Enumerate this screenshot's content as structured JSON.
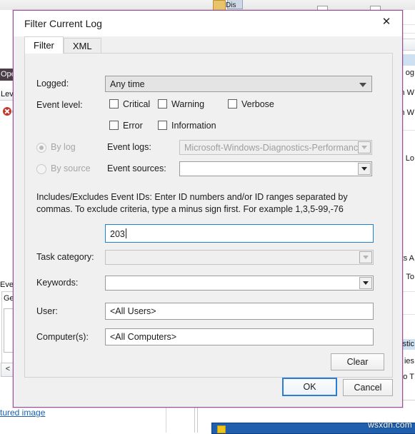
{
  "background": {
    "toolbar_label": "Dis",
    "left_selected_row": "Open",
    "left_column_header": "Leve",
    "left_error_row": "C",
    "lower_panel_title": "Even",
    "lower_panel_tab": "Ge",
    "prev_button": "<",
    "link_text": "tured image",
    "right_rows": [
      "og",
      "m W",
      "m W",
      "Lo",
      "ts A",
      "To",
      "stic",
      "ies",
      "o T"
    ],
    "watermark": "wsxdn.com"
  },
  "dialog": {
    "title": "Filter Current Log",
    "close_label": "✕",
    "tabs": [
      {
        "label": "Filter",
        "active": true
      },
      {
        "label": "XML",
        "active": false
      }
    ],
    "fields": {
      "logged_label": "Logged:",
      "logged_value": "Any time",
      "event_level_label": "Event level:",
      "levels": [
        {
          "label": "Critical",
          "checked": false
        },
        {
          "label": "Warning",
          "checked": false
        },
        {
          "label": "Verbose",
          "checked": false
        },
        {
          "label": "Error",
          "checked": false
        },
        {
          "label": "Information",
          "checked": false
        }
      ],
      "by_log_label": "By log",
      "by_source_label": "By source",
      "event_logs_label": "Event logs:",
      "event_logs_value": "Microsoft-Windows-Diagnostics-Performance",
      "event_sources_label": "Event sources:",
      "event_sources_value": "",
      "help_text": "Includes/Excludes Event IDs: Enter ID numbers and/or ID ranges separated by commas. To exclude criteria, type a minus sign first. For example 1,3,5-99,-76",
      "event_ids_value": "203",
      "task_category_label": "Task category:",
      "task_category_value": "",
      "keywords_label": "Keywords:",
      "keywords_value": "",
      "user_label": "User:",
      "user_value": "<All Users>",
      "computers_label": "Computer(s):",
      "computers_value": "<All Computers>"
    },
    "buttons": {
      "clear": "Clear",
      "ok": "OK",
      "cancel": "Cancel"
    }
  }
}
